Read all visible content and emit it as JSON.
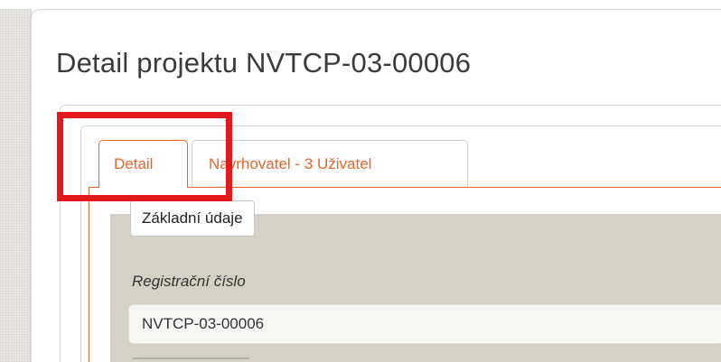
{
  "page": {
    "title": "Detail projektu NVTCP-03-00006"
  },
  "tabs": [
    {
      "label": "Detail",
      "active": true
    },
    {
      "label": "Navrhovatel - 3 Uživatel",
      "active": false
    }
  ],
  "section": {
    "legend": "Základní údaje",
    "fields": [
      {
        "label": "Registrační číslo",
        "value": "NVTCP-03-00006"
      }
    ]
  },
  "colors": {
    "accent": "#e4662a",
    "highlight": "#e3191b",
    "section_background": "#d4d0c5"
  }
}
